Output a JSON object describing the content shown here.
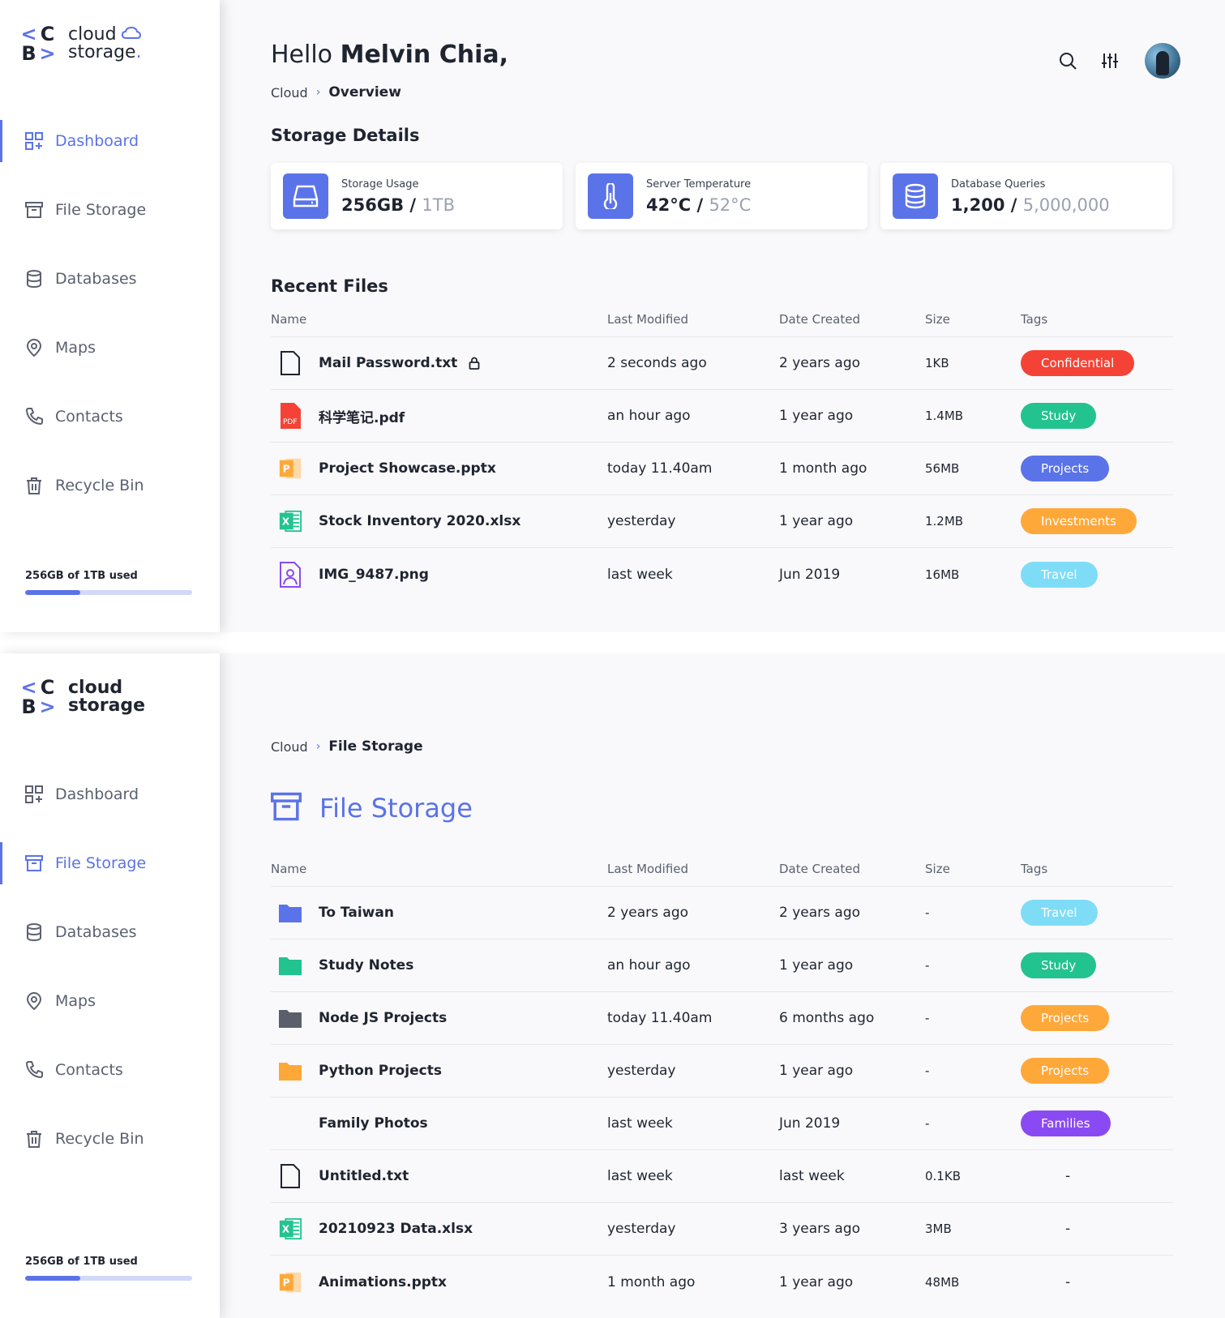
{
  "brand": {
    "logo_letters": [
      "<",
      "C",
      "B",
      ">"
    ],
    "name_line1": "cloud",
    "name_line2": "storage",
    "name_dot": "."
  },
  "colors": {
    "accent": "#5b73e8",
    "confidential": "#f44336",
    "study": "#22c38e",
    "projects_blue": "#5b73e8",
    "investments": "#ffa83a",
    "travel": "#7fdcf7",
    "families": "#8a4af3"
  },
  "nav": [
    {
      "label": "Dashboard",
      "icon": "dashboard-icon"
    },
    {
      "label": "File Storage",
      "icon": "archive-icon"
    },
    {
      "label": "Databases",
      "icon": "database-icon"
    },
    {
      "label": "Maps",
      "icon": "map-pin-icon"
    },
    {
      "label": "Contacts",
      "icon": "phone-icon"
    },
    {
      "label": "Recycle Bin",
      "icon": "trash-icon"
    }
  ],
  "usage": {
    "text": "256GB of 1TB used",
    "fraction": 0.33
  },
  "dashboard": {
    "greeting_prefix": "Hello",
    "user_name": "Melvin Chia,",
    "breadcrumb": {
      "root": "Cloud",
      "sep": "›",
      "current": "Overview"
    },
    "storage_title": "Storage Details",
    "cards": [
      {
        "label": "Storage Usage",
        "value": "256GB",
        "sep": " / ",
        "total": "1TB",
        "icon": "drive-icon"
      },
      {
        "label": "Server Temperature",
        "value": "42°C",
        "sep": " / ",
        "total": "52°C",
        "icon": "thermometer-icon"
      },
      {
        "label": "Database Queries",
        "value": "1,200",
        "sep": " / ",
        "total": "5,000,000",
        "icon": "database-icon"
      }
    ],
    "recent_title": "Recent Files",
    "columns": [
      "Name",
      "Last Modified",
      "Date Created",
      "Size",
      "Tags"
    ],
    "rows": [
      {
        "name": "Mail Password.txt",
        "locked": true,
        "icon": "text-file-icon",
        "modified": "2 seconds ago",
        "created": "2 years ago",
        "size": "1KB",
        "tag": "Confidential",
        "tag_color": "#f44336"
      },
      {
        "name": "科学笔记.pdf",
        "icon": "pdf-file-icon",
        "modified": "an hour ago",
        "created": "1 year ago",
        "size": "1.4MB",
        "tag": "Study",
        "tag_color": "#22c38e"
      },
      {
        "name": "Project Showcase.pptx",
        "icon": "pptx-file-icon",
        "modified": "today 11.40am",
        "created": "1 month ago",
        "size": "56MB",
        "tag": "Projects",
        "tag_color": "#5b73e8"
      },
      {
        "name": "Stock Inventory 2020.xlsx",
        "icon": "xlsx-file-icon",
        "modified": "yesterday",
        "created": "1 year ago",
        "size": "1.2MB",
        "tag": "Investments",
        "tag_color": "#ffa83a"
      },
      {
        "name": "IMG_9487.png",
        "icon": "image-file-icon",
        "modified": "last week",
        "created": "Jun 2019",
        "size": "16MB",
        "tag": "Travel",
        "tag_color": "#7fdcf7"
      }
    ]
  },
  "file_storage": {
    "breadcrumb": {
      "root": "Cloud",
      "sep": "›",
      "current": "File Storage"
    },
    "title": "File Storage",
    "columns": [
      "Name",
      "Last Modified",
      "Date Created",
      "Size",
      "Tags"
    ],
    "rows": [
      {
        "name": "To Taiwan",
        "icon": "folder-icon",
        "icon_color": "#5b73e8",
        "modified": "2 years ago",
        "created": "2 years ago",
        "size": "-",
        "tag": "Travel",
        "tag_color": "#7fdcf7"
      },
      {
        "name": "Study Notes",
        "icon": "folder-icon",
        "icon_color": "#22c38e",
        "modified": "an hour ago",
        "created": "1 year ago",
        "size": "-",
        "tag": "Study",
        "tag_color": "#22c38e"
      },
      {
        "name": "Node JS Projects",
        "icon": "folder-icon",
        "icon_color": "#5a5f6b",
        "modified": "today 11.40am",
        "created": "6 months ago",
        "size": "-",
        "tag": "Projects",
        "tag_color": "#ffa83a"
      },
      {
        "name": "Python Projects",
        "icon": "folder-icon",
        "icon_color": "#ffa83a",
        "modified": "yesterday",
        "created": "1 year ago",
        "size": "-",
        "tag": "Projects",
        "tag_color": "#ffa83a"
      },
      {
        "name": "Family Photos",
        "icon": "none",
        "modified": "last week",
        "created": "Jun 2019",
        "size": "-",
        "tag": "Families",
        "tag_color": "#8a4af3"
      },
      {
        "name": "Untitled.txt",
        "icon": "text-file-icon",
        "modified": "last week",
        "created": "last week",
        "size": "0.1KB",
        "tag": "-"
      },
      {
        "name": "20210923 Data.xlsx",
        "icon": "xlsx-file-icon",
        "modified": "yesterday",
        "created": "3 years ago",
        "size": "3MB",
        "tag": "-"
      },
      {
        "name": "Animations.pptx",
        "icon": "pptx-file-icon",
        "modified": "1 month ago",
        "created": "1 year ago",
        "size": "48MB",
        "tag": "-"
      }
    ]
  }
}
